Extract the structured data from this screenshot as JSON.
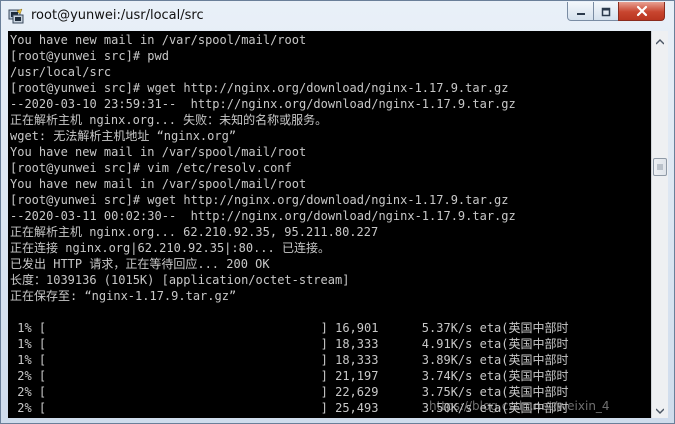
{
  "window": {
    "title": "root@yunwei:/usr/local/src",
    "icon": "putty-terminal-icon",
    "controls": [
      "minimize-icon",
      "maximize-icon",
      "close-icon"
    ]
  },
  "terminal": {
    "lines": [
      "You have new mail in /var/spool/mail/root",
      "[root@yunwei src]# pwd",
      "/usr/local/src",
      "[root@yunwei src]# wget http://nginx.org/download/nginx-1.17.9.tar.gz",
      "--2020-03-10 23:59:31--  http://nginx.org/download/nginx-1.17.9.tar.gz",
      "正在解析主机 nginx.org... 失败：未知的名称或服务。",
      "wget: 无法解析主机地址 “nginx.org”",
      "You have new mail in /var/spool/mail/root",
      "[root@yunwei src]# vim /etc/resolv.conf",
      "You have new mail in /var/spool/mail/root",
      "[root@yunwei src]# wget http://nginx.org/download/nginx-1.17.9.tar.gz",
      "--2020-03-11 00:02:30--  http://nginx.org/download/nginx-1.17.9.tar.gz",
      "正在解析主机 nginx.org... 62.210.92.35, 95.211.80.227",
      "正在连接 nginx.org|62.210.92.35|:80... 已连接。",
      "已发出 HTTP 请求，正在等待回应... 200 OK",
      "长度：1039136 (1015K) [application/octet-stream]",
      "正在保存至: “nginx-1.17.9.tar.gz”",
      "",
      " 1% [                                      ] 16,901      5.37K/s eta(英国中部时",
      " 1% [                                      ] 18,333      4.91K/s eta(英国中部时",
      " 1% [                                      ] 18,333      3.89K/s eta(英国中部时",
      " 2% [                                      ] 21,197      3.74K/s eta(英国中部时",
      " 2% [                                      ] 22,629      3.75K/s eta(英国中部时",
      " 2% [                                      ] 25,493      3.50K/s eta(英国中部时"
    ]
  },
  "watermark": "https://blog.csdn.net/weixin_4"
}
